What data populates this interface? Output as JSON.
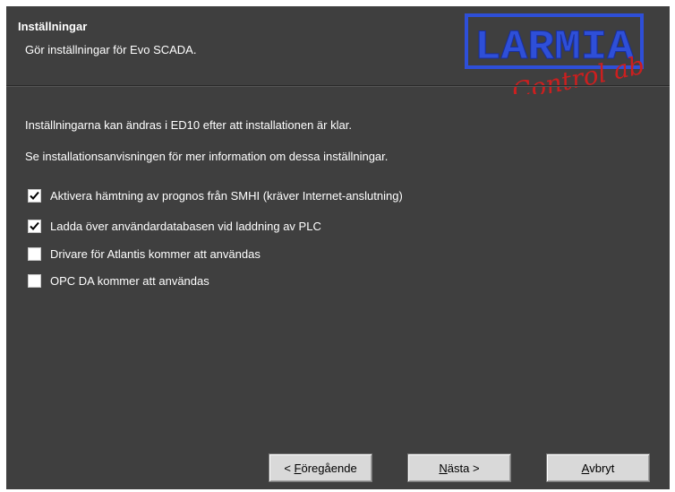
{
  "header": {
    "title": "Inställningar",
    "subtitle": "Gör inställningar för Evo SCADA.",
    "logo": {
      "brand": "LARMIA",
      "tagline": "Control ab"
    }
  },
  "info": {
    "line1": "Inställningarna kan ändras i ED10 efter att installationen är klar.",
    "line2": "Se installationsanvisningen för mer information om dessa inställningar."
  },
  "options": [
    {
      "label": "Aktivera hämtning av prognos från SMHI (kräver Internet-anslutning)",
      "checked": true
    },
    {
      "label": "Ladda över användardatabasen vid laddning av PLC",
      "checked": true
    },
    {
      "label": "Drivare för Atlantis kommer att användas",
      "checked": false
    },
    {
      "label": "OPC DA kommer att användas",
      "checked": false
    }
  ],
  "buttons": {
    "back": {
      "pre": "< ",
      "accel": "F",
      "post": "öregående"
    },
    "next": {
      "pre": "",
      "accel": "N",
      "post": "ästa >"
    },
    "cancel": {
      "pre": "",
      "accel": "A",
      "post": "vbryt"
    }
  },
  "colors": {
    "background": "#3f3f3f",
    "logo_blue": "#2e4fd8",
    "logo_red": "#cc1f1f"
  }
}
